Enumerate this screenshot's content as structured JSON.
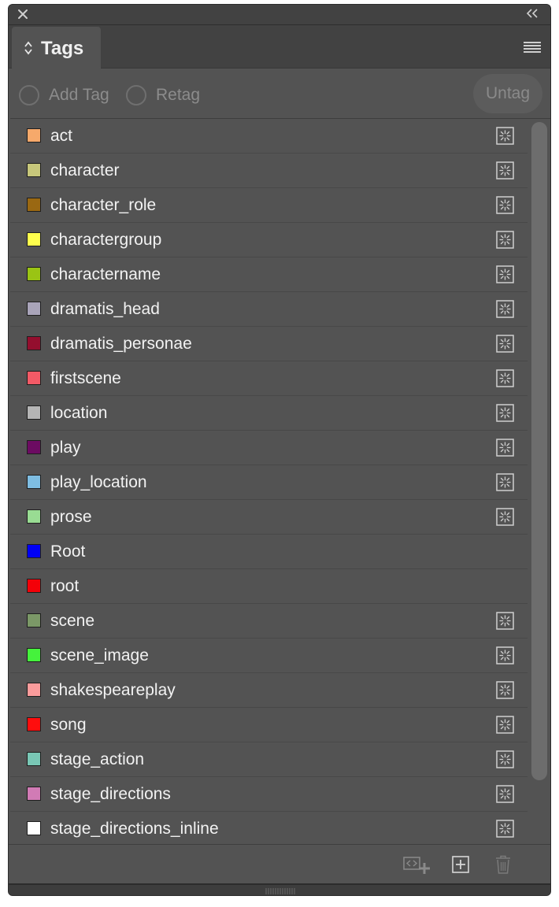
{
  "panel": {
    "tab_title": "Tags"
  },
  "controls": {
    "add_tag_label": "Add Tag",
    "retag_label": "Retag",
    "untag_label": "Untag"
  },
  "tags": [
    {
      "name": "act",
      "color": "#f6a96b",
      "mapped": true
    },
    {
      "name": "character",
      "color": "#c7c77b",
      "mapped": true
    },
    {
      "name": "character_role",
      "color": "#9a6812",
      "mapped": true
    },
    {
      "name": "charactergroup",
      "color": "#ffff4d",
      "mapped": true
    },
    {
      "name": "charactername",
      "color": "#9ac414",
      "mapped": true
    },
    {
      "name": "dramatis_head",
      "color": "#a9a4b9",
      "mapped": true
    },
    {
      "name": "dramatis_personae",
      "color": "#940e2e",
      "mapped": true
    },
    {
      "name": "firstscene",
      "color": "#f35a66",
      "mapped": true
    },
    {
      "name": "location",
      "color": "#b5b5b5",
      "mapped": true
    },
    {
      "name": "play",
      "color": "#6c0b62",
      "mapped": true
    },
    {
      "name": "play_location",
      "color": "#7ebde2",
      "mapped": true
    },
    {
      "name": "prose",
      "color": "#99dc93",
      "mapped": true
    },
    {
      "name": "Root",
      "color": "#0000f6",
      "mapped": false
    },
    {
      "name": "root",
      "color": "#f40008",
      "mapped": false
    },
    {
      "name": "scene",
      "color": "#7b9867",
      "mapped": true
    },
    {
      "name": "scene_image",
      "color": "#45f23c",
      "mapped": true
    },
    {
      "name": "shakespeareplay",
      "color": "#fa9c9c",
      "mapped": true
    },
    {
      "name": "song",
      "color": "#ff0d0d",
      "mapped": true
    },
    {
      "name": "stage_action",
      "color": "#79c7b5",
      "mapped": true
    },
    {
      "name": "stage_directions",
      "color": "#d17bb5",
      "mapped": true
    },
    {
      "name": "stage_directions_inline",
      "color": "#ffffff",
      "mapped": true
    }
  ]
}
